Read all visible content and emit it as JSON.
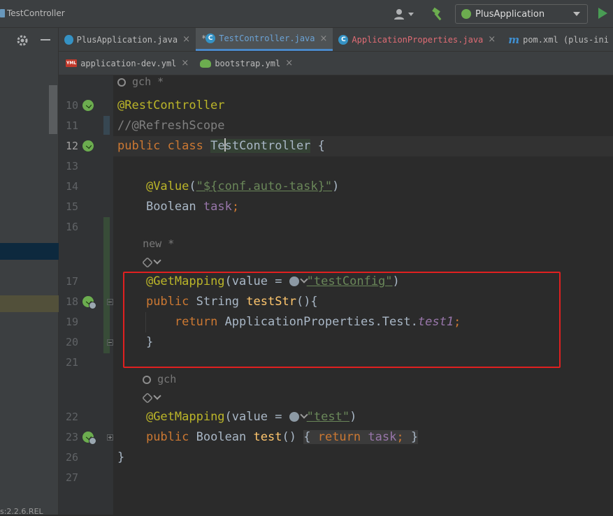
{
  "titlebar": {
    "breadcrumb": "TestController",
    "run_config": "PlusApplication"
  },
  "colors": {
    "highlight_box": "#e02020",
    "accent": "#4a88c7",
    "spring": "#6cad4f"
  },
  "left_panel": {
    "bottom_text": "s:2.2.6.REL"
  },
  "tabs_row1": [
    {
      "label": "PlusApplication.java",
      "icon": "spring-class-icon"
    },
    {
      "label": "TestController.java",
      "icon": "class-icon",
      "active": true,
      "modified_mark": "*"
    },
    {
      "label": "ApplicationProperties.java",
      "icon": "class-icon"
    },
    {
      "label": "pom.xml (plus-ini",
      "icon": "maven-icon"
    }
  ],
  "tabs_row2": [
    {
      "label": "application-dev.yml",
      "icon": "yml-icon"
    },
    {
      "label": "bootstrap.yml",
      "icon": "spring-boot-icon"
    }
  ],
  "code": {
    "author_hint_top": "gch *",
    "line_numbers": [
      "10",
      "11",
      "12",
      "13",
      "14",
      "15",
      "16",
      "17",
      "18",
      "19",
      "20",
      "21",
      "22",
      "23",
      "26",
      "27"
    ],
    "ann_restcontroller": "@RestController",
    "comment_refresh": "//@RefreshScope",
    "kw_public": "public",
    "kw_class": "class",
    "class_name_a": "Te",
    "class_name_b": "stController",
    "brace_open": "{",
    "brace_close": "}",
    "ann_value": "@Value",
    "value_str": "\"${conf.auto-task}\"",
    "boolean_type": "Boolean",
    "field_task": "task",
    "semicolon": ";",
    "author_hint_new": "new *",
    "ann_getmapping": "@GetMapping",
    "value_eq": "(value = ",
    "mapping1_str": "\"testConfig\"",
    "paren_close": ")",
    "string_type": "String",
    "method_teststr": "testStr",
    "method_sig_end": "(){",
    "kw_return": "return",
    "return_expr": "ApplicationProperties.Test.",
    "field_test1": "test1",
    "author_hint_gch": "gch",
    "mapping2_str": "\"test\"",
    "method_test": "test",
    "method_test_parens": "()",
    "folded_body_return": "return",
    "folded_body_field": "task",
    "folded_semicolon": ";"
  }
}
